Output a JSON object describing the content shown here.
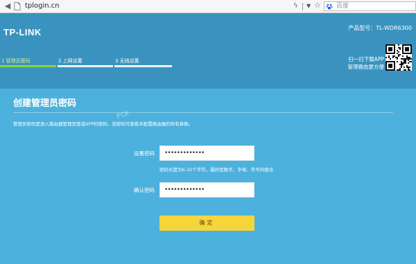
{
  "browser": {
    "url": "tplogin.cn",
    "search_placeholder": "百度",
    "icons": {
      "back": "back-arrow-icon",
      "page": "page-icon",
      "lightning": "lightning-icon",
      "star": "star-icon",
      "search_engine": "baidu-logo-icon"
    }
  },
  "header": {
    "brand": "TP-LINK",
    "product_model": "产品型号：TL-WDR6300",
    "app_promo_line1": "扫一扫下载APP",
    "app_promo_line2": "管理路由更方便",
    "steps": [
      {
        "label": "1 管理员密码",
        "active": true
      },
      {
        "label": "2 上网设置",
        "active": false
      },
      {
        "label": "3 无线设置",
        "active": false
      }
    ],
    "progress_fraction": 0.33
  },
  "panel": {
    "title": "创建管理员密码",
    "description": "管理员密码是进入路由器管理页面或APP的密码，该密码可查看并配置路由器的所有参数。",
    "watermark": "PCH",
    "set_password_label": "设置密码",
    "set_password_value": "•••••••••••••",
    "password_hint": "密码长度为6-32个字符，最好是数字、字母、符号的组合",
    "confirm_password_label": "确认密码",
    "confirm_password_value": "•••••••••••••",
    "confirm_button": "确定"
  },
  "colors": {
    "header_bg": "#3a93bf",
    "panel_bg": "#4db1dd",
    "progress_active": "#8ed23c",
    "button": "#f5d53a"
  }
}
